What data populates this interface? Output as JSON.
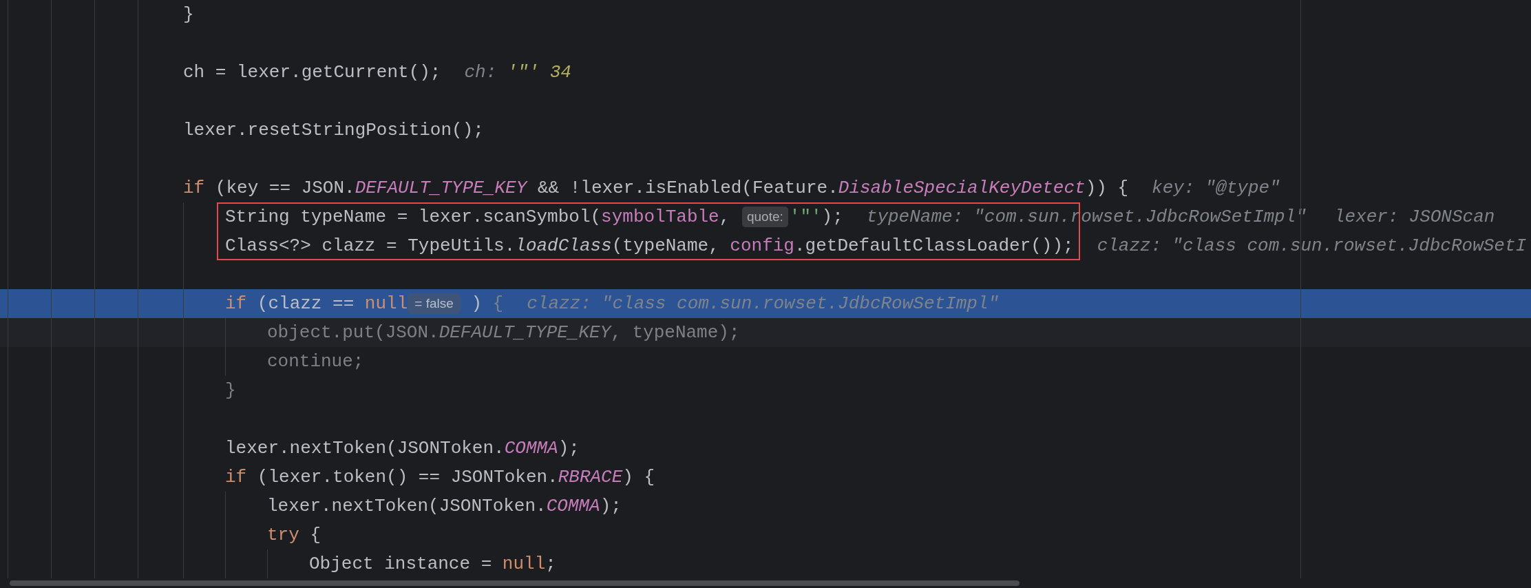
{
  "editor": {
    "lines": [
      {
        "kind": "code",
        "code": [
          {
            "text": "}",
            "kind": "plain"
          }
        ]
      },
      {
        "kind": "blank"
      },
      {
        "kind": "code",
        "code": [
          {
            "text": "ch = lexer.getCurrent();",
            "kind": "plain"
          }
        ],
        "hints": [
          {
            "name": "ch:",
            "value": "'\"' 34",
            "kind": "char"
          }
        ]
      },
      {
        "kind": "blank"
      },
      {
        "kind": "code",
        "code": [
          {
            "text": "lexer.resetStringPosition();",
            "kind": "plain"
          }
        ]
      },
      {
        "kind": "blank"
      },
      {
        "kind": "code",
        "code": [
          {
            "text": "if",
            "kind": "keyword"
          },
          {
            "text": " (key == JSON.",
            "kind": "plain"
          },
          {
            "text": "DEFAULT_TYPE_KEY",
            "kind": "constant"
          },
          {
            "text": " && !lexer.isEnabled(Feature.",
            "kind": "plain"
          },
          {
            "text": "DisableSpecialKeyDetect",
            "kind": "constant"
          },
          {
            "text": ")) {",
            "kind": "plain"
          }
        ],
        "hints": [
          {
            "name": "key:",
            "value": "\"@type\"",
            "kind": "text"
          }
        ],
        "children": [
          {
            "kind": "code",
            "boxed": true,
            "code": [
              {
                "text": "String typeName = lexer.scanSymbol(",
                "kind": "plain"
              },
              {
                "text": "symbolTable",
                "kind": "field"
              },
              {
                "text": ", ",
                "kind": "plain"
              },
              {
                "text": "quote:",
                "kind": "param_hint"
              },
              {
                "text": "'\"'",
                "kind": "string"
              },
              {
                "text": ");",
                "kind": "plain"
              }
            ],
            "hints": [
              {
                "name": "typeName:",
                "value": "\"com.sun.rowset.JdbcRowSetImpl\"",
                "kind": "text"
              },
              {
                "name": "lexer:",
                "value": "JSONScan",
                "kind": "text"
              }
            ]
          },
          {
            "kind": "code",
            "boxed": true,
            "code": [
              {
                "text": "Class<?> clazz = TypeUtils.",
                "kind": "plain"
              },
              {
                "text": "loadClass",
                "kind": "static_call"
              },
              {
                "text": "(typeName, ",
                "kind": "plain"
              },
              {
                "text": "config",
                "kind": "field"
              },
              {
                "text": ".getDefaultClassLoader());",
                "kind": "plain"
              }
            ],
            "hints": [
              {
                "name": "clazz:",
                "value": "\"class com.sun.rowset.JdbcRowSetI",
                "kind": "text"
              }
            ]
          },
          {
            "kind": "blank"
          },
          {
            "kind": "code",
            "execution": true,
            "code": [
              {
                "text": "if",
                "kind": "keyword"
              },
              {
                "text": " (clazz == ",
                "kind": "plain"
              },
              {
                "text": "null",
                "kind": "keyword"
              },
              {
                "text": "= false",
                "kind": "value_badge"
              },
              {
                "text": " ) ",
                "kind": "plain"
              },
              {
                "text": "{",
                "kind": "dim"
              }
            ],
            "hints": [
              {
                "name": "clazz:",
                "value": "\"class com.sun.rowset.JdbcRowSetImpl\"",
                "kind": "text"
              }
            ],
            "children": [
              {
                "kind": "code",
                "caret": true,
                "code": [
                  {
                    "text": "object.put(JSON.",
                    "kind": "dim"
                  },
                  {
                    "text": "DEFAULT_TYPE_KEY",
                    "kind": "dim_constant"
                  },
                  {
                    "text": ", typeName);",
                    "kind": "dim"
                  }
                ]
              },
              {
                "kind": "code",
                "code": [
                  {
                    "text": "continue;",
                    "kind": "dim"
                  }
                ]
              }
            ]
          },
          {
            "kind": "code",
            "code": [
              {
                "text": "}",
                "kind": "dim"
              }
            ]
          },
          {
            "kind": "blank"
          },
          {
            "kind": "code",
            "code": [
              {
                "text": "lexer.nextToken(JSONToken.",
                "kind": "plain"
              },
              {
                "text": "COMMA",
                "kind": "constant"
              },
              {
                "text": ");",
                "kind": "plain"
              }
            ]
          },
          {
            "kind": "code",
            "code": [
              {
                "text": "if",
                "kind": "keyword"
              },
              {
                "text": " (lexer.token() == JSONToken.",
                "kind": "plain"
              },
              {
                "text": "RBRACE",
                "kind": "constant"
              },
              {
                "text": ") {",
                "kind": "plain"
              }
            ],
            "children": [
              {
                "kind": "code",
                "code": [
                  {
                    "text": "lexer.nextToken(JSONToken.",
                    "kind": "plain"
                  },
                  {
                    "text": "COMMA",
                    "kind": "constant"
                  },
                  {
                    "text": ");",
                    "kind": "plain"
                  }
                ]
              },
              {
                "kind": "code",
                "code": [
                  {
                    "text": "try",
                    "kind": "keyword"
                  },
                  {
                    "text": " {",
                    "kind": "plain"
                  }
                ],
                "children": [
                  {
                    "kind": "code",
                    "code": [
                      {
                        "text": "Object instance = ",
                        "kind": "plain"
                      },
                      {
                        "text": "null",
                        "kind": "keyword"
                      },
                      {
                        "text": ";",
                        "kind": "plain"
                      }
                    ]
                  }
                ]
              }
            ]
          }
        ]
      }
    ]
  }
}
